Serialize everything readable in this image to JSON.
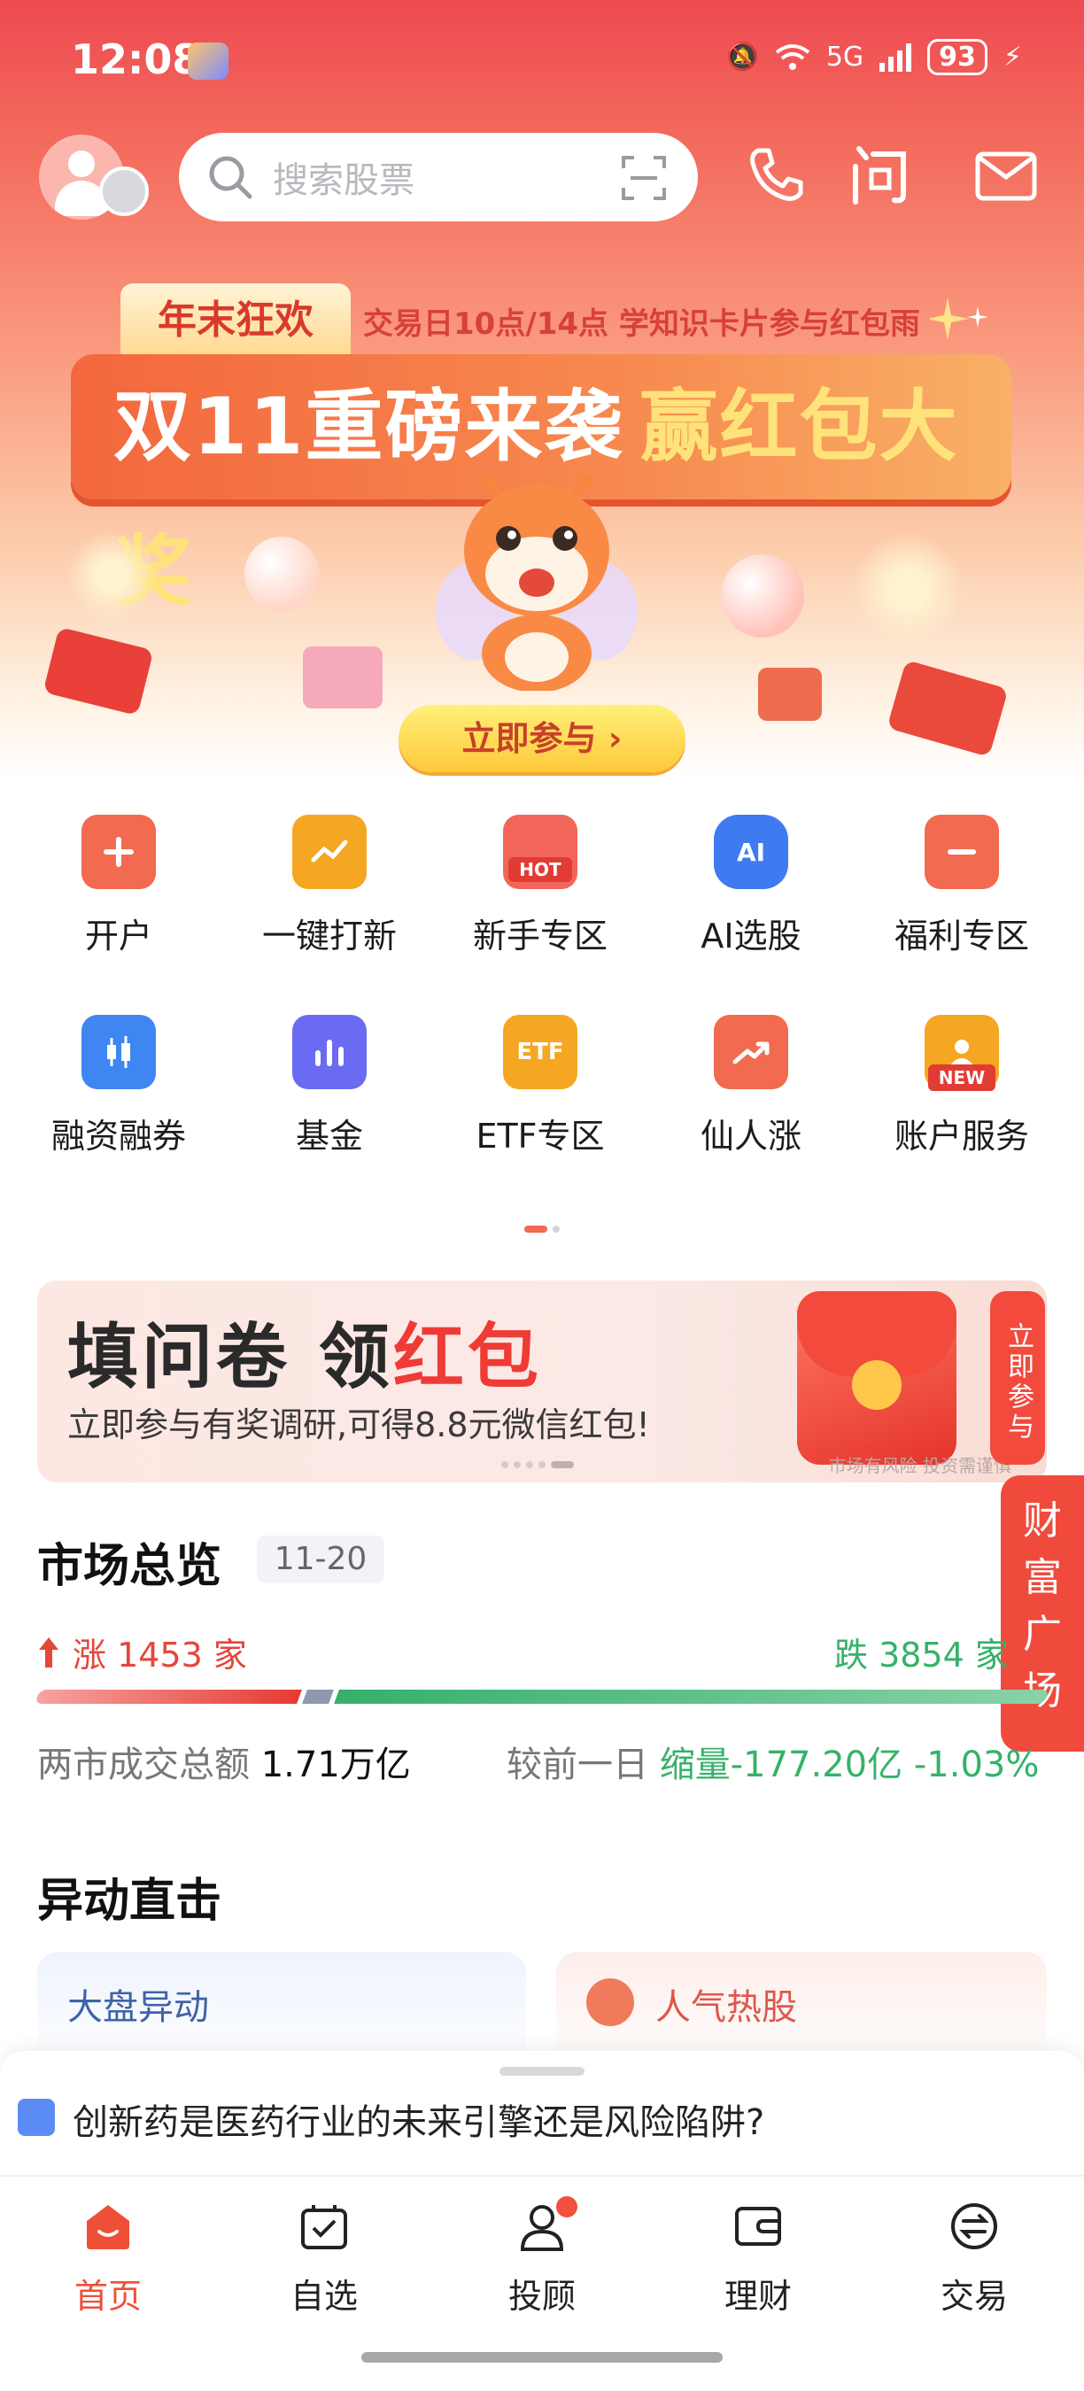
{
  "status_bar": {
    "time": "12:08",
    "network": "5G",
    "battery": "93"
  },
  "header": {
    "search_placeholder": "搜索股票"
  },
  "banner": {
    "tag": "年末狂欢",
    "subtitle": "交易日10点/14点 学知识卡片参与红包雨",
    "title_white": "双11重磅来袭",
    "title_gold": "赢红包大奖",
    "cta": "立即参与"
  },
  "grid": {
    "items": [
      {
        "label": "开户",
        "icon": "plus-icon",
        "color": "#f26a4f"
      },
      {
        "label": "一键打新",
        "icon": "trend-card-icon",
        "color": "#f5a623"
      },
      {
        "label": "新手专区",
        "icon": "gift-hot-icon",
        "color": "#f2665a",
        "badge": "HOT"
      },
      {
        "label": "AI选股",
        "icon": "ai-shield-icon",
        "color": "#3f7bf0",
        "badge": "AI"
      },
      {
        "label": "福利专区",
        "icon": "gift-box-icon",
        "color": "#f26a4f"
      },
      {
        "label": "融资融券",
        "icon": "candlestick-icon",
        "color": "#3f86f2"
      },
      {
        "label": "基金",
        "icon": "bar-chart-icon",
        "color": "#6a6af2"
      },
      {
        "label": "ETF专区",
        "icon": "etf-icon",
        "color": "#f5a623",
        "badge": "ETF"
      },
      {
        "label": "仙人涨",
        "icon": "rising-arrow-icon",
        "color": "#f26a4f"
      },
      {
        "label": "账户服务",
        "icon": "account-icon",
        "color": "#f5a623",
        "badge": "NEW"
      }
    ]
  },
  "survey": {
    "title_black": "填问卷 ",
    "title_black2": "领",
    "title_red": "红包",
    "subtitle": "立即参与有奖调研,可得8.8元微信红包!",
    "join": "立即参与",
    "note": "市场有风险 投资需谨慎"
  },
  "wealth_tab": "财富广场",
  "market": {
    "title": "市场总览",
    "date": "11-20",
    "up_text": "涨 1453 家",
    "down_text": "跌 3854 家",
    "volume_label": "两市成交总额",
    "volume_value": "1.71万亿",
    "compare_label": "较前一日",
    "compare_value": "缩量-177.20亿",
    "compare_pct": "-1.03%"
  },
  "anomaly": {
    "title": "异动直击",
    "left_card": "大盘异动",
    "right_card": "人气热股"
  },
  "sheet": {
    "text": "创新药是医药行业的未来引擎还是风险陷阱?"
  },
  "tabbar": {
    "items": [
      {
        "label": "首页",
        "active": true
      },
      {
        "label": "自选",
        "active": false
      },
      {
        "label": "投顾",
        "active": false
      },
      {
        "label": "理财",
        "active": false
      },
      {
        "label": "交易",
        "active": false
      }
    ]
  }
}
